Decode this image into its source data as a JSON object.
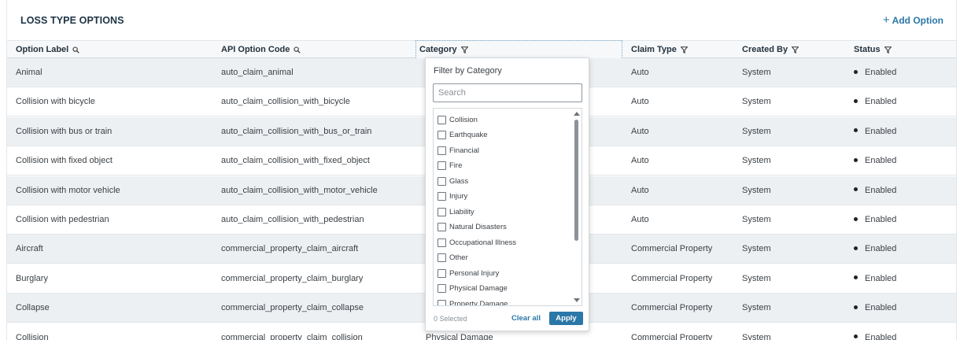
{
  "header": {
    "title": "LOSS TYPE OPTIONS",
    "add_label": "Add Option",
    "add_icon": "plus-icon"
  },
  "columns": [
    {
      "label": "Option Label",
      "icon": "search-icon"
    },
    {
      "label": "API Option Code",
      "icon": "search-icon"
    },
    {
      "label": "Category",
      "icon": "filter-icon"
    },
    {
      "label": "Claim Type",
      "icon": "filter-icon"
    },
    {
      "label": "Created By",
      "icon": "filter-icon"
    },
    {
      "label": "Status",
      "icon": "filter-icon"
    }
  ],
  "rows": [
    {
      "label": "Animal",
      "code": "auto_claim_animal",
      "category": "",
      "claim_type": "Auto",
      "created_by": "System",
      "status": "Enabled"
    },
    {
      "label": "Collision with bicycle",
      "code": "auto_claim_collision_with_bicycle",
      "category": "",
      "claim_type": "Auto",
      "created_by": "System",
      "status": "Enabled"
    },
    {
      "label": "Collision with bus or train",
      "code": "auto_claim_collision_with_bus_or_train",
      "category": "",
      "claim_type": "Auto",
      "created_by": "System",
      "status": "Enabled"
    },
    {
      "label": "Collision with fixed object",
      "code": "auto_claim_collision_with_fixed_object",
      "category": "",
      "claim_type": "Auto",
      "created_by": "System",
      "status": "Enabled"
    },
    {
      "label": "Collision with motor vehicle",
      "code": "auto_claim_collision_with_motor_vehicle",
      "category": "",
      "claim_type": "Auto",
      "created_by": "System",
      "status": "Enabled"
    },
    {
      "label": "Collision with pedestrian",
      "code": "auto_claim_collision_with_pedestrian",
      "category": "",
      "claim_type": "Auto",
      "created_by": "System",
      "status": "Enabled"
    },
    {
      "label": "Aircraft",
      "code": "commercial_property_claim_aircraft",
      "category": "",
      "claim_type": "Commercial Property",
      "created_by": "System",
      "status": "Enabled"
    },
    {
      "label": "Burglary",
      "code": "commercial_property_claim_burglary",
      "category": "",
      "claim_type": "Commercial Property",
      "created_by": "System",
      "status": "Enabled"
    },
    {
      "label": "Collapse",
      "code": "commercial_property_claim_collapse",
      "category": "",
      "claim_type": "Commercial Property",
      "created_by": "System",
      "status": "Enabled"
    },
    {
      "label": "Collision",
      "code": "commercial_property_claim_collision",
      "category": "Physical Damage",
      "claim_type": "Commercial Property",
      "created_by": "System",
      "status": "Enabled"
    }
  ],
  "filter": {
    "title": "Filter by Category",
    "search_placeholder": "Search",
    "options": [
      "Collision",
      "Earthquake",
      "Financial",
      "Fire",
      "Glass",
      "Injury",
      "Liability",
      "Natural Disasters",
      "Occupational Illness",
      "Other",
      "Personal Injury",
      "Physical Damage",
      "Property Damage"
    ],
    "selected_count": "0 Selected",
    "clear_label": "Clear all",
    "apply_label": "Apply"
  },
  "colors": {
    "accent": "#2a77a8",
    "title": "#1d3344",
    "row_alt": "#edf0f2"
  }
}
